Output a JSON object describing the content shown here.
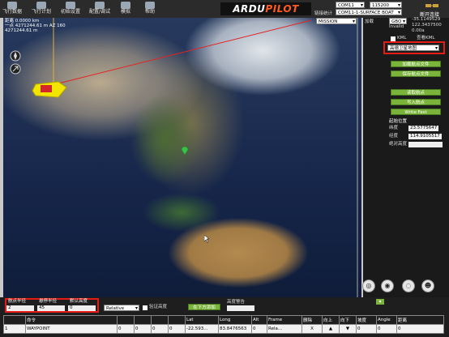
{
  "toolbar": {
    "items": [
      {
        "label": "飞行数据",
        "icon": "flight-data-icon"
      },
      {
        "label": "飞行计划",
        "icon": "flight-plan-icon"
      },
      {
        "label": "初始设置",
        "icon": "initial-setup-icon"
      },
      {
        "label": "配置/调试",
        "icon": "config-tuning-icon"
      },
      {
        "label": "模拟",
        "icon": "simulation-icon"
      },
      {
        "label": "帮助",
        "icon": "help-icon"
      }
    ],
    "logo_prefix": "ARDU",
    "logo_suffix": "PILOT",
    "port": "COM11",
    "baud": "115200",
    "link_label": "链接统计",
    "link_value": "COM11-1-SURFACE BOAT",
    "disconnect": "断开连接"
  },
  "map_info": {
    "line1": "距离  0.0000 km",
    "line2": "一点  4271244.61 m AZ 160",
    "line3": "      4271244.61 m"
  },
  "right_panel": {
    "mode": "MISSION",
    "load_label": "加载",
    "gps": "GBO",
    "lat_top": "-35.1149529",
    "lng_top": "122.3437500",
    "invalid": "Invalid",
    "alt_top": "0.00a",
    "kml_label": "KML",
    "view_label": "查看KML",
    "map_provider": "高德卫星地图",
    "buttons": [
      "加载航点文件",
      "保存航点文件",
      "读取航点",
      "写入航点",
      "Write Fast"
    ],
    "home_title": "起始位置",
    "lat_label": "纬度",
    "lat_value": "23.5775647",
    "lng_label": "经度",
    "lng_value": "114.9105517",
    "alt_label": "绝对高度"
  },
  "bottom": {
    "wp_radius": "航点半径",
    "loiter_radius": "悬停半径",
    "default_alt": "默认高度",
    "wp_radius_val": "2",
    "loiter_radius_val": "45",
    "default_alt_val": "0",
    "frame": "Relative",
    "verify_alt": "验证高度",
    "add_below": "在下方添加",
    "alt_warning": "高度警告",
    "columns": [
      "",
      "命令",
      "",
      "",
      "",
      "",
      "Lat",
      "Long",
      "Alt",
      "Frame",
      "删除",
      "向上",
      "向下",
      "坡度",
      "Angle",
      "距离"
    ],
    "row": {
      "idx": "1",
      "command": "WAYPOINT",
      "p1": "0",
      "p2": "0",
      "p3": "0",
      "p4": "0",
      "lat": "-22.593...",
      "lng": "83.8476563",
      "alt": "0",
      "frame": "Rela...",
      "del": "X",
      "grad": "0",
      "angle": "0",
      "dist": "0"
    }
  },
  "colors": {
    "accent_red": "#e41b17",
    "button_green": "#7ab43a",
    "home_marker": "#38c24a",
    "boat_yellow": "#f2e600"
  }
}
